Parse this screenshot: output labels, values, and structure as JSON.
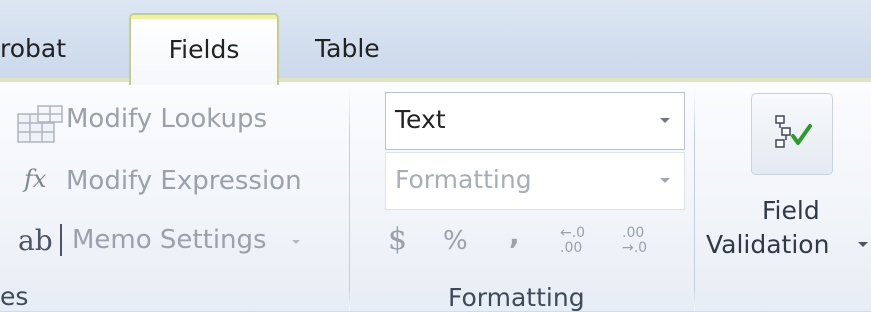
{
  "tabs": [
    {
      "label": "robat"
    },
    {
      "label": "Fields",
      "active": true
    },
    {
      "label": "Table"
    }
  ],
  "properties_group": {
    "items": [
      {
        "label": "Modify Lookups",
        "icon": "lookup-grid-icon"
      },
      {
        "label": "Modify Expression",
        "icon": "fx-icon",
        "icon_text": "fx"
      },
      {
        "label": "Memo Settings",
        "icon": "ab-icon",
        "icon_text": "ab",
        "has_dropdown": true
      }
    ],
    "label": "es"
  },
  "formatting_group": {
    "data_type": {
      "value": "Text"
    },
    "format": {
      "value": "Formatting"
    },
    "buttons": [
      {
        "name": "currency",
        "text": "$"
      },
      {
        "name": "percent",
        "text": "%"
      },
      {
        "name": "comma",
        "text": ","
      },
      {
        "name": "increase-decimals",
        "text": "←.0 .00"
      },
      {
        "name": "decrease-decimals",
        "text": ".00 →.0"
      }
    ],
    "label": "Formatting"
  },
  "validation_group": {
    "button_line1": "Field",
    "button_line2": "Validation",
    "icon": "field-validation-icon"
  },
  "colors": {
    "accent_tab_border": "#c4cd8f",
    "check_green": "#2d9a2d",
    "disabled_text": "#9aa1aa"
  }
}
